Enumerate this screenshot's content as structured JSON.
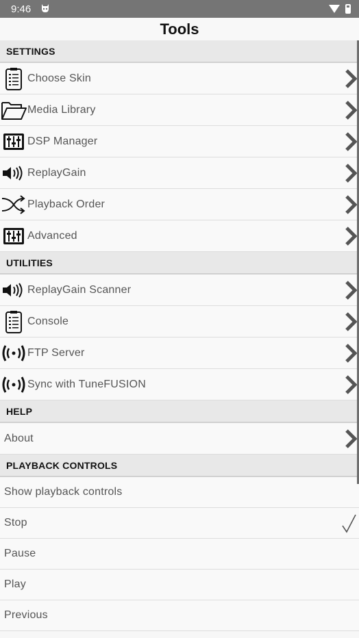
{
  "status_bar": {
    "time": "9:46"
  },
  "title": "Tools",
  "sections": [
    {
      "header": "SETTINGS",
      "items": [
        {
          "label": "Choose Skin",
          "icon": "clipboard-list-icon",
          "chevron": true
        },
        {
          "label": "Media Library",
          "icon": "folder-open-icon",
          "chevron": true
        },
        {
          "label": "DSP Manager",
          "icon": "equalizer-icon",
          "chevron": true
        },
        {
          "label": "ReplayGain",
          "icon": "speaker-icon",
          "chevron": true
        },
        {
          "label": "Playback Order",
          "icon": "shuffle-icon",
          "chevron": true
        },
        {
          "label": "Advanced",
          "icon": "equalizer-icon",
          "chevron": true
        }
      ]
    },
    {
      "header": "UTILITIES",
      "items": [
        {
          "label": "ReplayGain Scanner",
          "icon": "speaker-icon",
          "chevron": true
        },
        {
          "label": "Console",
          "icon": "clipboard-list-icon",
          "chevron": true
        },
        {
          "label": "FTP Server",
          "icon": "broadcast-icon",
          "chevron": true
        },
        {
          "label": "Sync with TuneFUSION",
          "icon": "broadcast-icon",
          "chevron": true
        }
      ]
    },
    {
      "header": "HELP",
      "items": [
        {
          "label": "About",
          "chevron": true
        }
      ]
    },
    {
      "header": "PLAYBACK CONTROLS",
      "items": [
        {
          "label": "Show playback controls"
        },
        {
          "label": "Stop",
          "checked": true
        },
        {
          "label": "Pause"
        },
        {
          "label": "Play"
        },
        {
          "label": "Previous"
        }
      ]
    }
  ]
}
